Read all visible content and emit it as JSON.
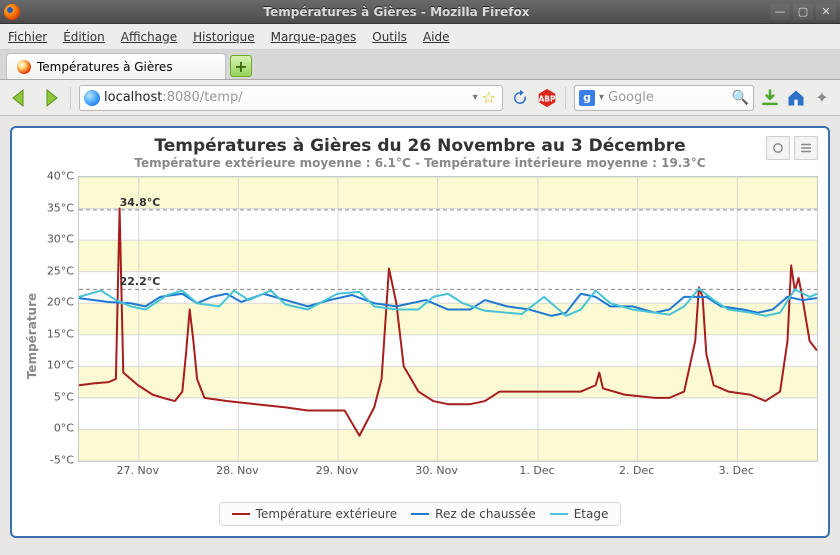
{
  "window": {
    "title": "Températures à Gières - Mozilla Firefox"
  },
  "menu": {
    "items": [
      "Fichier",
      "Édition",
      "Affichage",
      "Historique",
      "Marque-pages",
      "Outils",
      "Aide"
    ]
  },
  "tabs": {
    "active_label": "Températures à Gières"
  },
  "url": {
    "host": "localhost",
    "port": ":8080",
    "path": "/temp/"
  },
  "search": {
    "engine_label": "g",
    "placeholder": "Google"
  },
  "chart_data": {
    "type": "line",
    "title": "Températures à Gières du 26 Novembre au 3 Décembre",
    "subtitle": "Température extérieure moyenne : 6.1°C - Température intérieure moyenne : 19.3°C",
    "xlabel": "",
    "ylabel": "Température",
    "ylim": [
      -5,
      40
    ],
    "yticks": [
      -5,
      0,
      5,
      10,
      15,
      20,
      25,
      30,
      35,
      40
    ],
    "ytick_labels": [
      "-5°C",
      "0°C",
      "5°C",
      "10°C",
      "15°C",
      "20°C",
      "25°C",
      "30°C",
      "35°C",
      "40°C"
    ],
    "xticks": [
      "27. Nov",
      "28. Nov",
      "29. Nov",
      "30. Nov",
      "1. Dec",
      "2. Dec",
      "3. Dec"
    ],
    "xtick_positions": [
      0.081,
      0.216,
      0.351,
      0.486,
      0.622,
      0.757,
      0.892
    ],
    "reference_lines": [
      {
        "value": 34.8,
        "label": "34.8°C",
        "x_pos": 0.055
      },
      {
        "value": 22.2,
        "label": "22.2°C",
        "x_pos": 0.055
      }
    ],
    "legend": [
      {
        "name": "Température extérieure",
        "color": "#a61e1e"
      },
      {
        "name": "Rez de chaussée",
        "color": "#1f78d1"
      },
      {
        "name": "Etage",
        "color": "#46c4d6"
      }
    ],
    "series": [
      {
        "name": "Température extérieure",
        "color": "#a61e1e",
        "points": [
          [
            0.0,
            7.0
          ],
          [
            0.02,
            7.3
          ],
          [
            0.04,
            7.5
          ],
          [
            0.05,
            8.0
          ],
          [
            0.055,
            35.0
          ],
          [
            0.06,
            9.0
          ],
          [
            0.08,
            7.0
          ],
          [
            0.1,
            5.5
          ],
          [
            0.12,
            4.8
          ],
          [
            0.13,
            4.5
          ],
          [
            0.14,
            6.0
          ],
          [
            0.145,
            12.0
          ],
          [
            0.15,
            19.0
          ],
          [
            0.155,
            14.0
          ],
          [
            0.16,
            8.0
          ],
          [
            0.17,
            5.0
          ],
          [
            0.2,
            4.5
          ],
          [
            0.24,
            4.0
          ],
          [
            0.28,
            3.5
          ],
          [
            0.31,
            3.0
          ],
          [
            0.34,
            3.0
          ],
          [
            0.36,
            3.0
          ],
          [
            0.38,
            -1.0
          ],
          [
            0.4,
            3.5
          ],
          [
            0.41,
            8.0
          ],
          [
            0.42,
            25.5
          ],
          [
            0.43,
            20.0
          ],
          [
            0.44,
            10.0
          ],
          [
            0.46,
            6.0
          ],
          [
            0.48,
            4.5
          ],
          [
            0.5,
            4.0
          ],
          [
            0.53,
            4.0
          ],
          [
            0.55,
            4.5
          ],
          [
            0.57,
            6.0
          ],
          [
            0.6,
            6.0
          ],
          [
            0.64,
            6.0
          ],
          [
            0.68,
            6.0
          ],
          [
            0.7,
            7.0
          ],
          [
            0.705,
            9.0
          ],
          [
            0.71,
            6.5
          ],
          [
            0.74,
            5.5
          ],
          [
            0.78,
            5.0
          ],
          [
            0.8,
            5.0
          ],
          [
            0.82,
            6.0
          ],
          [
            0.835,
            14.0
          ],
          [
            0.84,
            22.5
          ],
          [
            0.845,
            21.0
          ],
          [
            0.85,
            12.0
          ],
          [
            0.86,
            7.0
          ],
          [
            0.88,
            6.0
          ],
          [
            0.91,
            5.5
          ],
          [
            0.93,
            4.5
          ],
          [
            0.95,
            6.0
          ],
          [
            0.96,
            14.0
          ],
          [
            0.965,
            26.0
          ],
          [
            0.97,
            22.0
          ],
          [
            0.975,
            24.0
          ],
          [
            0.98,
            21.0
          ],
          [
            0.99,
            14.0
          ],
          [
            1.0,
            12.5
          ]
        ]
      },
      {
        "name": "Rez de chaussée",
        "color": "#1f78d1",
        "points": [
          [
            0.0,
            20.8
          ],
          [
            0.04,
            20.2
          ],
          [
            0.07,
            20.0
          ],
          [
            0.09,
            19.5
          ],
          [
            0.11,
            21.0
          ],
          [
            0.14,
            21.5
          ],
          [
            0.16,
            20.0
          ],
          [
            0.18,
            21.0
          ],
          [
            0.2,
            21.5
          ],
          [
            0.22,
            20.2
          ],
          [
            0.25,
            21.5
          ],
          [
            0.28,
            20.5
          ],
          [
            0.31,
            19.5
          ],
          [
            0.34,
            20.5
          ],
          [
            0.37,
            21.3
          ],
          [
            0.4,
            20.0
          ],
          [
            0.43,
            19.5
          ],
          [
            0.47,
            20.5
          ],
          [
            0.5,
            19.0
          ],
          [
            0.53,
            19.0
          ],
          [
            0.55,
            20.5
          ],
          [
            0.58,
            19.5
          ],
          [
            0.61,
            19.0
          ],
          [
            0.64,
            18.0
          ],
          [
            0.66,
            18.5
          ],
          [
            0.68,
            21.5
          ],
          [
            0.7,
            21.0
          ],
          [
            0.72,
            19.5
          ],
          [
            0.75,
            19.5
          ],
          [
            0.78,
            18.5
          ],
          [
            0.8,
            19.0
          ],
          [
            0.82,
            21.0
          ],
          [
            0.85,
            21.0
          ],
          [
            0.87,
            19.5
          ],
          [
            0.9,
            19.0
          ],
          [
            0.92,
            18.5
          ],
          [
            0.94,
            19.0
          ],
          [
            0.96,
            21.0
          ],
          [
            0.98,
            20.5
          ],
          [
            1.0,
            20.8
          ]
        ]
      },
      {
        "name": "Etage",
        "color": "#46c4d6",
        "points": [
          [
            0.0,
            21.0
          ],
          [
            0.03,
            22.0
          ],
          [
            0.05,
            20.5
          ],
          [
            0.07,
            19.5
          ],
          [
            0.09,
            19.0
          ],
          [
            0.12,
            21.3
          ],
          [
            0.14,
            22.0
          ],
          [
            0.16,
            20.0
          ],
          [
            0.19,
            19.5
          ],
          [
            0.21,
            22.0
          ],
          [
            0.23,
            20.5
          ],
          [
            0.26,
            22.0
          ],
          [
            0.28,
            19.8
          ],
          [
            0.31,
            19.0
          ],
          [
            0.35,
            21.5
          ],
          [
            0.38,
            21.8
          ],
          [
            0.4,
            19.5
          ],
          [
            0.43,
            19.0
          ],
          [
            0.46,
            19.0
          ],
          [
            0.48,
            21.0
          ],
          [
            0.5,
            21.5
          ],
          [
            0.52,
            20.0
          ],
          [
            0.55,
            18.8
          ],
          [
            0.58,
            18.5
          ],
          [
            0.6,
            18.3
          ],
          [
            0.63,
            21.0
          ],
          [
            0.66,
            18.0
          ],
          [
            0.68,
            19.0
          ],
          [
            0.7,
            22.0
          ],
          [
            0.72,
            20.0
          ],
          [
            0.75,
            19.0
          ],
          [
            0.78,
            18.5
          ],
          [
            0.8,
            18.2
          ],
          [
            0.82,
            19.5
          ],
          [
            0.84,
            22.3
          ],
          [
            0.86,
            20.5
          ],
          [
            0.88,
            19.0
          ],
          [
            0.91,
            18.5
          ],
          [
            0.93,
            18.0
          ],
          [
            0.95,
            18.5
          ],
          [
            0.97,
            22.2
          ],
          [
            0.99,
            21.0
          ],
          [
            1.0,
            21.5
          ]
        ]
      }
    ]
  }
}
